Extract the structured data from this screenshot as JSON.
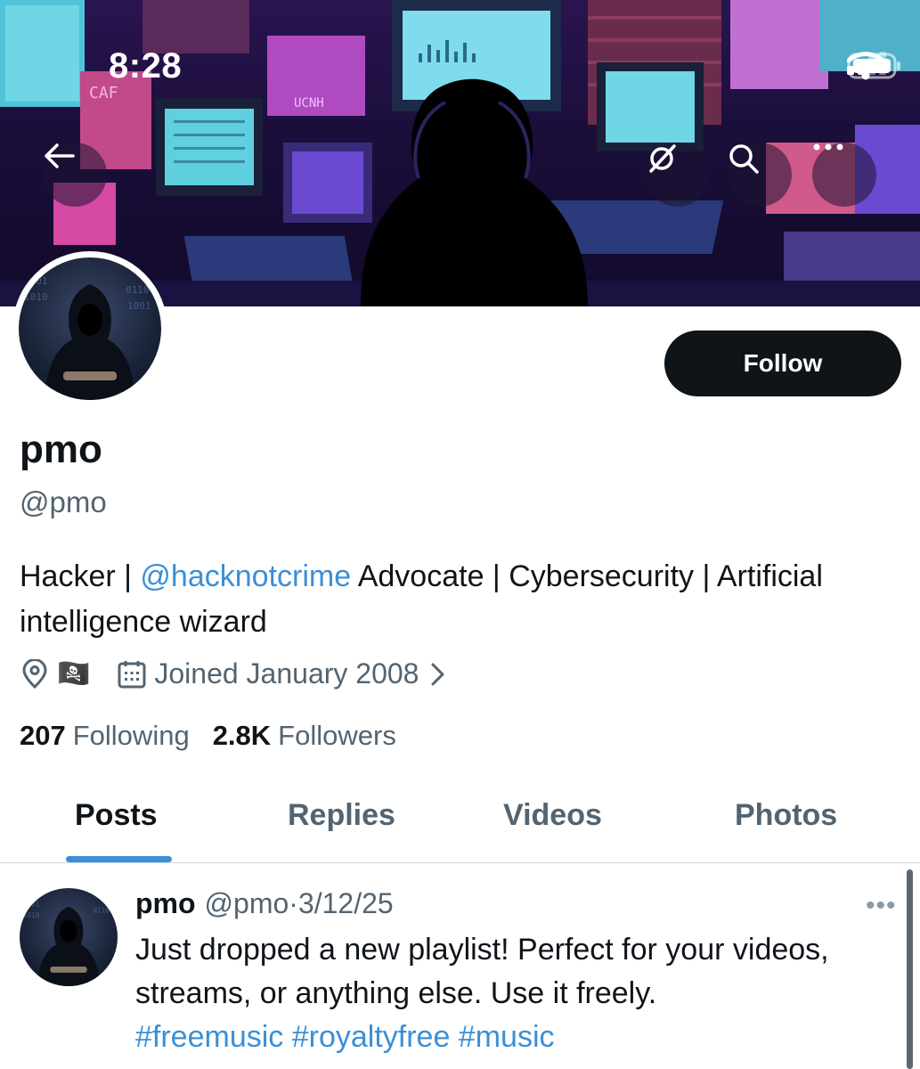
{
  "status_bar": {
    "time": "8:28"
  },
  "nav": {
    "back_icon": "arrow-left-icon",
    "grok_icon": "grok-icon",
    "search_icon": "search-icon",
    "more_icon": "more-horizontal-icon"
  },
  "banner": {
    "screen_texts": [
      "CAF",
      "UCNH"
    ]
  },
  "profile": {
    "display_name": "pmo",
    "handle": "@pmo",
    "follow_label": "Follow",
    "bio_prefix": "Hacker | ",
    "bio_mention": "@hacknotcrime",
    "bio_suffix": " Advocate | Cybersecurity | Artificial intelligence wizard",
    "location_flag": "🏴‍☠️",
    "joined": "Joined January 2008",
    "following_count": "207",
    "following_label": "Following",
    "followers_count": "2.8K",
    "followers_label": "Followers"
  },
  "tabs": [
    {
      "label": "Posts"
    },
    {
      "label": "Replies"
    },
    {
      "label": "Videos"
    },
    {
      "label": "Photos"
    }
  ],
  "post": {
    "name": "pmo",
    "handle": "@pmo",
    "separator": "·",
    "date": "3/12/25",
    "more": "•••",
    "text": "Just dropped a new playlist! Perfect for your videos, streams, or anything else. Use it freely.",
    "hashtags": "#freemusic #royaltyfree #music"
  },
  "colors": {
    "accent": "#3b8fd6",
    "text": "#0f1419",
    "muted": "#536471"
  }
}
